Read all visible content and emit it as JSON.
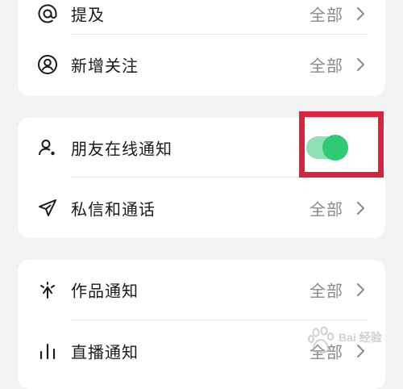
{
  "groups": [
    {
      "rows": [
        {
          "label": "提及",
          "value": "全部",
          "icon": "at-icon"
        },
        {
          "label": "新增关注",
          "value": "全部",
          "icon": "user-circle-icon"
        }
      ]
    },
    {
      "rows": [
        {
          "label": "朋友在线通知",
          "toggle": true,
          "icon": "user-online-icon"
        },
        {
          "label": "私信和通话",
          "value": "全部",
          "icon": "paper-plane-icon"
        }
      ]
    },
    {
      "rows": [
        {
          "label": "作品通知",
          "value": "全部",
          "icon": "sparkle-icon"
        },
        {
          "label": "直播通知",
          "value": "全部",
          "icon": "bar-chart-icon"
        }
      ]
    }
  ],
  "colors": {
    "toggle_on": "#2ecb74",
    "toggle_track": "#8fe0b4",
    "highlight_box": "#d8243e"
  },
  "watermark": {
    "text": "Bai 经验"
  }
}
